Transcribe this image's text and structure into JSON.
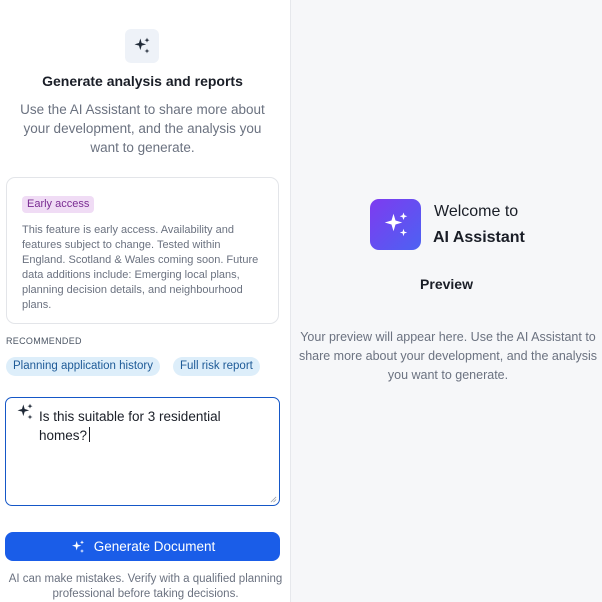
{
  "left": {
    "hero": {
      "icon": "sparkle-icon",
      "title": "Generate analysis and reports",
      "description": "Use the AI Assistant to share more about your development, and the analysis you want to generate."
    },
    "notice": {
      "badge": "Early access",
      "text": "This feature is early access. Availability and features subject to change. Tested within England. Scotland & Wales coming soon. Future data additions include: Emerging local plans, planning decision details, and neighbourhood plans."
    },
    "recommended": {
      "label": "RECOMMENDED",
      "chips": [
        "Planning application history",
        "Full risk report"
      ]
    },
    "prompt": {
      "icon": "sparkle-icon",
      "value": "Is this suitable for 3 residential homes?"
    },
    "generate_button": {
      "icon": "sparkle-icon",
      "label": "Generate Document"
    },
    "disclaimer": "AI can make mistakes. Verify with a qualified planning professional before taking decisions."
  },
  "right": {
    "logo_icon": "sparkle-icon",
    "welcome_line1": "Welcome to",
    "welcome_line2": "AI Assistant",
    "preview_title": "Preview",
    "preview_description": "Your preview will appear here. Use the AI Assistant to share more about your development, and the analysis you want to generate."
  },
  "colors": {
    "primary_button": "#1a5de8",
    "chip_bg": "#ddeefa",
    "badge_bg": "#f0dcf5",
    "logo_gradient_start": "#7e3bf0",
    "logo_gradient_end": "#4c62f2"
  }
}
